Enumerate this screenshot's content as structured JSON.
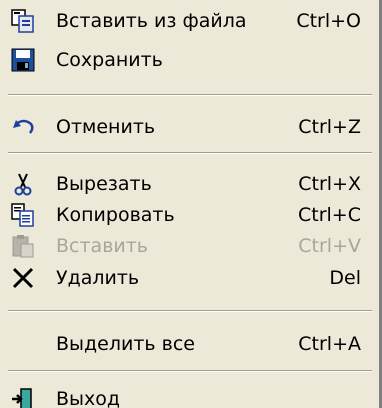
{
  "menu": {
    "items": [
      {
        "label": "Вставить из файла",
        "shortcut": "Ctrl+O",
        "icon": "insert-from-file-icon"
      },
      {
        "label": "Сохранить",
        "shortcut": "",
        "icon": "save-floppy-icon"
      },
      {
        "label": "Отменить",
        "shortcut": "Ctrl+Z",
        "icon": "undo-icon"
      },
      {
        "label": "Вырезать",
        "shortcut": "Ctrl+X",
        "icon": "scissors-icon"
      },
      {
        "label": "Копировать",
        "shortcut": "Ctrl+C",
        "icon": "copy-icon"
      },
      {
        "label": "Вставить",
        "shortcut": "Ctrl+V",
        "icon": "paste-icon",
        "disabled": true
      },
      {
        "label": "Удалить",
        "shortcut": "Del",
        "icon": "delete-x-icon"
      },
      {
        "label": "Выделить все",
        "shortcut": "Ctrl+A",
        "icon": ""
      },
      {
        "label": "Выход",
        "shortcut": "",
        "icon": "exit-door-icon"
      }
    ]
  },
  "colors": {
    "menu_bg": "#ece9d8",
    "disabled_text": "#a7a69c",
    "separator_dark": "#a09d8a",
    "save_blue": "#1e4f9c",
    "undo_blue": "#1f3f9f"
  }
}
